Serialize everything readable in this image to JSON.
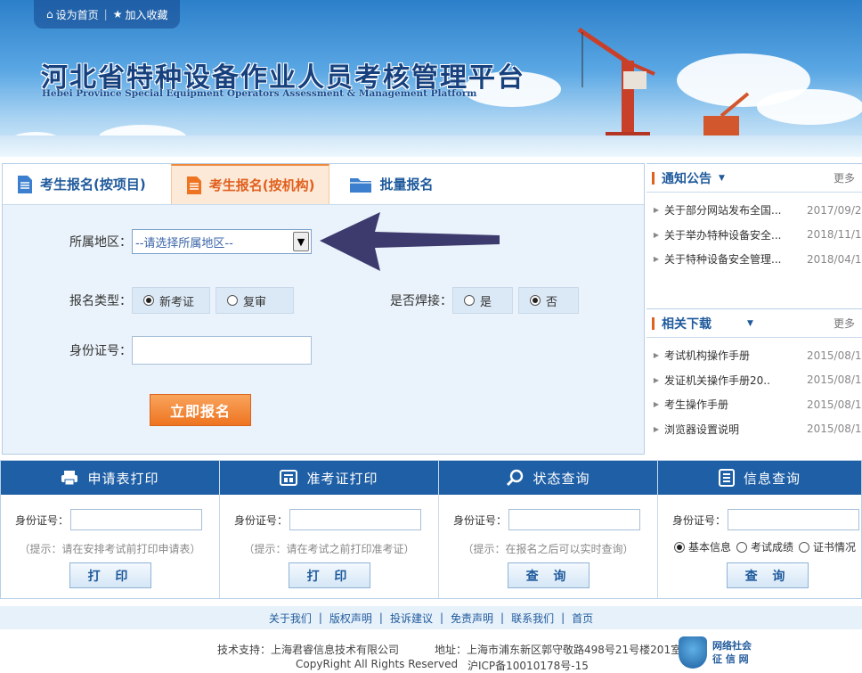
{
  "topbar": {
    "home": "设为首页",
    "fav": "加入收藏"
  },
  "site": {
    "title": "河北省特种设备作业人员考核管理平台",
    "subtitle": "Hebei Province Special Equipment Operators Assessment & Management Platform"
  },
  "register": {
    "tabs": [
      "考生报名(按项目)",
      "考生报名(按机构)",
      "批量报名"
    ],
    "region_label": "所属地区：",
    "region_value": "--请选择所属地区--",
    "type_label": "报名类型：",
    "type_options": [
      "新考证",
      "复审"
    ],
    "weld_label": "是否焊接：",
    "weld_options": [
      "是",
      "否"
    ],
    "id_label": "身份证号：",
    "submit": "立即报名"
  },
  "notices": {
    "title": "通知公告",
    "more": "更多",
    "items": [
      {
        "title": "关于部分网站发布全国...",
        "date": "2017/09/2"
      },
      {
        "title": "关于举办特种设备安全...",
        "date": "2018/11/1"
      },
      {
        "title": "关于特种设备安全管理...",
        "date": "2018/04/1"
      }
    ]
  },
  "downloads": {
    "title": "相关下载",
    "more": "更多",
    "items": [
      {
        "title": "考试机构操作手册",
        "date": "2015/08/1"
      },
      {
        "title": "发证机关操作手册20..",
        "date": "2015/08/1"
      },
      {
        "title": "考生操作手册",
        "date": "2015/08/1"
      },
      {
        "title": "浏览器设置说明",
        "date": "2015/08/1"
      }
    ]
  },
  "services": [
    {
      "title": "申请表打印",
      "label": "身份证号：",
      "hint": "（提示：请在安排考试前打印申请表）",
      "button": "打 印"
    },
    {
      "title": "准考证打印",
      "label": "身份证号：",
      "hint": "（提示：请在考试之前打印准考证）",
      "button": "打 印"
    },
    {
      "title": "状态查询",
      "label": "身份证号：",
      "hint": "（提示：在报名之后可以实时查询）",
      "button": "查 询"
    },
    {
      "title": "信息查询",
      "label": "身份证号：",
      "options": [
        "基本信息",
        "考试成绩",
        "证书情况"
      ],
      "button": "查 询"
    }
  ],
  "footer": {
    "links": [
      "关于我们",
      "版权声明",
      "投诉建议",
      "免责声明",
      "联系我们",
      "首页"
    ],
    "tech": "技术支持：上海君睿信息技术有限公司",
    "address": "地址：上海市浦东新区郭守敬路498号21号楼201室",
    "copyright": "CopyRight All Rights Reserved",
    "icp": "沪ICP备10010178号-15",
    "badge_line1": "网络社会",
    "badge_line2": "征 信 网"
  }
}
